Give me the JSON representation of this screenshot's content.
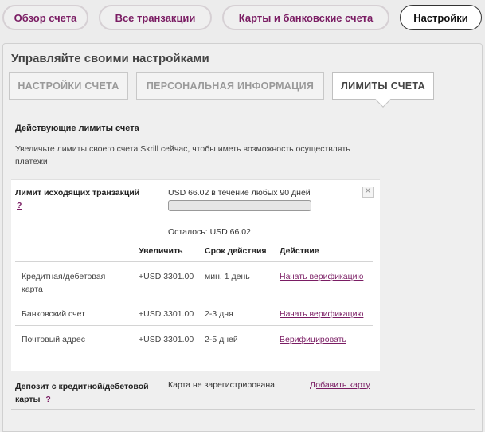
{
  "nav": {
    "items": [
      {
        "label": "Обзор счета"
      },
      {
        "label": "Все транзакции"
      },
      {
        "label": "Карты и банковские счета"
      },
      {
        "label": "Настройки"
      }
    ]
  },
  "settings": {
    "title": "Управляйте своими настройками",
    "tabs": [
      {
        "label": "НАСТРОЙКИ СЧЕТА"
      },
      {
        "label": "ПЕРСОНАЛЬНАЯ ИНФОРМАЦИЯ"
      },
      {
        "label": "ЛИМИТЫ СЧЕТА"
      }
    ],
    "active_tab": 2
  },
  "limits": {
    "heading": "Действующие лимиты счета",
    "description": "Увеличьте лимиты своего счета Skrill сейчас, чтобы иметь возможность осуществлять платежи",
    "outgoing": {
      "label": "Лимит исходящих транзакций",
      "help": "?",
      "amount": "USD 66.02 в течение любых 90 дней",
      "used_fraction": 0,
      "remaining": "Осталось: USD 66.02",
      "close": "✕"
    },
    "table": {
      "headers": {
        "increase": "Увеличить",
        "duration": "Срок действия",
        "action": "Действие"
      },
      "rows": [
        {
          "method": "Кредитная/дебетовая карта",
          "increase": "+USD 3301.00",
          "duration": "мин. 1 день",
          "action": "Начать верификацию"
        },
        {
          "method": "Банковский счет",
          "increase": "+USD 3301.00",
          "duration": "2-3 дня",
          "action": "Начать верификацию"
        },
        {
          "method": "Почтовый адрес",
          "increase": "+USD 3301.00",
          "duration": "2-5 дней",
          "action": "Верифицировать"
        }
      ]
    }
  },
  "deposit": {
    "label": "Депозит с кредитной/дебетовой карты",
    "help": "?",
    "status": "Карта не зарегистрирована",
    "action": "Добавить карту"
  },
  "colors": {
    "accent": "#7a1c63",
    "panel_bg": "#efefef",
    "page_bg": "#ececec"
  }
}
